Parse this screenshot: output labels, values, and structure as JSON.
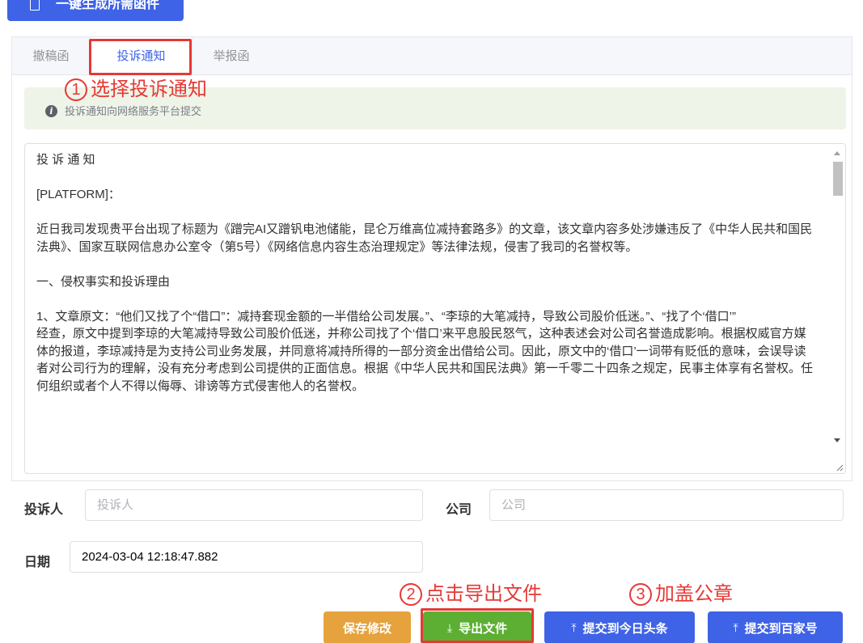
{
  "top_button": {
    "label": "一键生成所需函件"
  },
  "tabs": [
    {
      "label": "撤稿函"
    },
    {
      "label": "投诉通知"
    },
    {
      "label": "举报函"
    }
  ],
  "annotations": {
    "step1": {
      "num": "1",
      "text": "选择投诉通知"
    },
    "step2": {
      "num": "2",
      "text": "点击导出文件"
    },
    "step3": {
      "num": "3",
      "text": "加盖公章"
    }
  },
  "tip": {
    "icon": "info-icon",
    "text": "投诉通知向网络服务平台提交"
  },
  "document": {
    "paragraphs": [
      "投 诉 通 知",
      "[PLATFORM]：",
      "近日我司发现贵平台出现了标题为《蹭完AI又蹭钒电池储能，昆仑万维高位减持套路多》的文章，该文章内容多处涉嫌违反了《中华人民共和国民法典》、国家互联网信息办公室令（第5号）《网络信息内容生态治理规定》等法律法规，侵害了我司的名誉权等。",
      "一、侵权事实和投诉理由",
      "1、文章原文：“他们又找了个“借口”：减持套现金额的一半借给公司发展。”、“李琼的大笔减持，导致公司股价低迷。”、“找了个‘借口’”",
      "经查，原文中提到李琼的大笔减持导致公司股价低迷，并称公司找了个‘借口’来平息股民怒气，这种表述会对公司名誉造成影响。根据权威官方媒体的报道，李琼减持是为支持公司业务发展，并同意将减持所得的一部分资金出借给公司。因此，原文中的‘借口’一词带有贬低的意味，会误导读者对公司行为的理解，没有充分考虑到公司提供的正面信息。根据《中华人民共和国民法典》第一千零二十四条之规定，民事主体享有名誉权。任何组织或者个人不得以侮辱、诽谤等方式侵害他人的名誉权。"
    ]
  },
  "form": {
    "complainant": {
      "label": "投诉人",
      "placeholder": "投诉人",
      "value": ""
    },
    "company": {
      "label": "公司",
      "placeholder": "公司",
      "value": ""
    },
    "date": {
      "label": "日期",
      "value": "2024-03-04 12:18:47.882"
    }
  },
  "buttons": {
    "save": "保存修改",
    "export": "导出文件",
    "toutiao": "提交到今日头条",
    "baijia": "提交到百家号"
  },
  "colors": {
    "primary": "#3f63e6",
    "warning": "#e6a23c",
    "success": "#5daf34",
    "annotation_red": "#e53935",
    "tip_bg": "#eef4e8"
  }
}
